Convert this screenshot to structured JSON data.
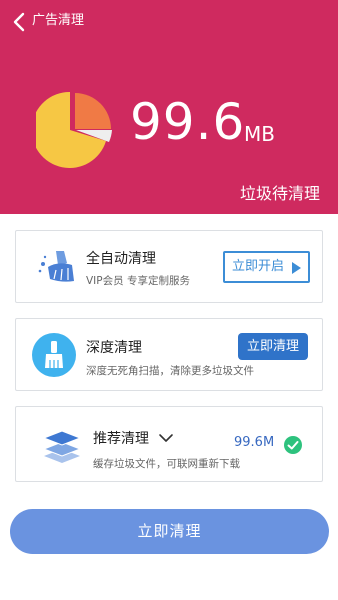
{
  "header": {
    "title": "广告清理",
    "size_value": "99.6",
    "size_unit": "MB",
    "status_label": "垃圾待清理",
    "background_color": "#cf2a5f"
  },
  "cards": {
    "auto_clean": {
      "title": "全自动清理",
      "subtitle": "VIP会员 专享定制服务",
      "button_label": "立即开启",
      "icon": "broom-sparkle-icon"
    },
    "deep_clean": {
      "title": "深度清理",
      "subtitle": "深度无死角扫描，清除更多垃圾文件",
      "button_label": "立即清理",
      "icon": "brush-icon"
    },
    "recommended": {
      "title": "推荐清理",
      "subtitle": "缓存垃圾文件，可联网重新下载",
      "size": "99.6M",
      "icon": "layers-icon",
      "selected": true
    }
  },
  "footer": {
    "clean_button_label": "立即清理"
  }
}
